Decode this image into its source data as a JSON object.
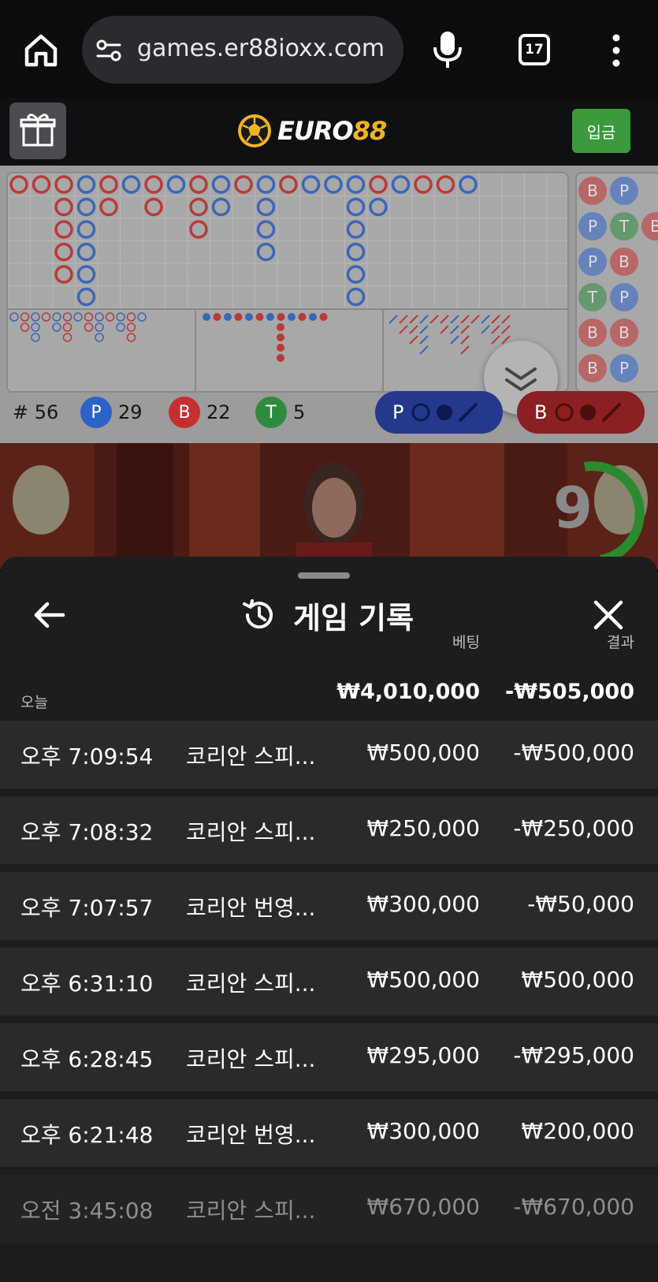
{
  "browser": {
    "url": "games.er88ioxx.com",
    "tab_count": "17",
    "icons": [
      "home-icon",
      "site-settings-icon",
      "mic-icon",
      "tab-switcher-icon",
      "more-vert-icon"
    ]
  },
  "site": {
    "logo_main": "EURO",
    "logo_accent": "88",
    "deposit_label": "입금",
    "colors": {
      "brand_gold": "#f2b322",
      "deposit_green": "#3a9a3c"
    }
  },
  "scoreboard": {
    "round_count": "# 56",
    "player_letter": "P",
    "player_wins": "29",
    "banker_letter": "B",
    "banker_wins": "22",
    "tie_letter": "T",
    "tie_count": "5",
    "predict_player_label": "P",
    "predict_banker_label": "B",
    "side_beads": [
      [
        "B",
        "P",
        ""
      ],
      [
        "P",
        "T",
        "B"
      ],
      [
        "P",
        "B",
        ""
      ],
      [
        "T",
        "P",
        ""
      ],
      [
        "B",
        "B",
        ""
      ],
      [
        "B",
        "P",
        ""
      ]
    ],
    "colors": {
      "player": "#2d63c8",
      "banker": "#c62f2f",
      "tie": "#2e8a3f"
    }
  },
  "video": {
    "countdown": "9"
  },
  "history_sheet": {
    "title": "게임 기록",
    "col_bet": "베팅",
    "col_result": "결과",
    "today_label": "오늘",
    "total_bet": "₩4,010,000",
    "total_result": "-₩505,000",
    "rows": [
      {
        "time": "오후 7:09:54",
        "game": "코리안 스피...",
        "bet": "₩500,000",
        "result": "-₩500,000"
      },
      {
        "time": "오후 7:08:32",
        "game": "코리안 스피...",
        "bet": "₩250,000",
        "result": "-₩250,000"
      },
      {
        "time": "오후 7:07:57",
        "game": "코리안 번영...",
        "bet": "₩300,000",
        "result": "-₩50,000"
      },
      {
        "time": "오후 6:31:10",
        "game": "코리안 스피...",
        "bet": "₩500,000",
        "result": "₩500,000"
      },
      {
        "time": "오후 6:28:45",
        "game": "코리안 스피...",
        "bet": "₩295,000",
        "result": "-₩295,000"
      },
      {
        "time": "오후 6:21:48",
        "game": "코리안 번영...",
        "bet": "₩300,000",
        "result": "₩200,000"
      },
      {
        "time": "오전 3:45:08",
        "game": "코리안 스피...",
        "bet": "₩670,000",
        "result": "-₩670,000"
      }
    ]
  }
}
